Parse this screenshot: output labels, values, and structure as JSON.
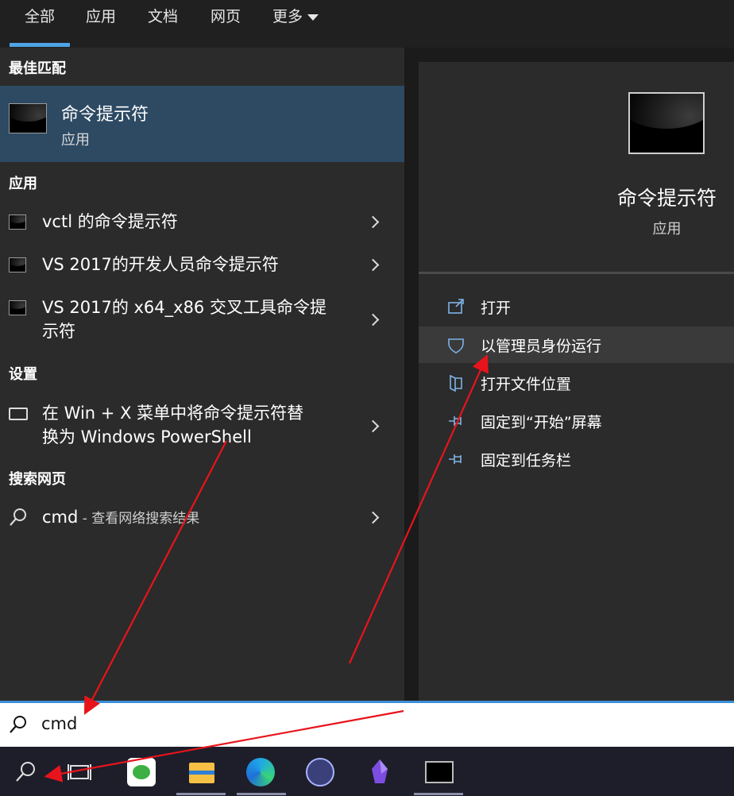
{
  "tabs": [
    {
      "label": "全部",
      "active": true
    },
    {
      "label": "应用"
    },
    {
      "label": "文档"
    },
    {
      "label": "网页"
    },
    {
      "label": "更多"
    }
  ],
  "left": {
    "best_match_header": "最佳匹配",
    "best_match": {
      "title": "命令提示符",
      "subtitle": "应用"
    },
    "apps_header": "应用",
    "apps": [
      {
        "label": "vctl 的命令提示符"
      },
      {
        "label": "VS 2017的开发人员命令提示符"
      },
      {
        "label_line1": "VS 2017的 x64_x86 交叉工具命令提",
        "label_line2": "示符"
      }
    ],
    "settings_header": "设置",
    "setting": {
      "line1": "在 Win + X 菜单中将命令提示符替",
      "line2": "换为 Windows PowerShell"
    },
    "web_header": "搜索网页",
    "web": {
      "query": "cmd",
      "suffix": " - 查看网络搜索结果"
    }
  },
  "detail": {
    "title": "命令提示符",
    "subtitle": "应用",
    "actions": [
      {
        "label": "打开",
        "icon": "open-icon"
      },
      {
        "label": "以管理员身份运行",
        "icon": "shield-icon",
        "highlighted": true
      },
      {
        "label": "打开文件位置",
        "icon": "file-location-icon"
      },
      {
        "label": "固定到“开始”屏幕",
        "icon": "pin-icon"
      },
      {
        "label": "固定到任务栏",
        "icon": "pin-icon"
      }
    ]
  },
  "search": {
    "value": "cmd"
  },
  "colors": {
    "accent": "#3a8fd6",
    "selected": "#2e4a63",
    "arrow": "#e8141b"
  }
}
